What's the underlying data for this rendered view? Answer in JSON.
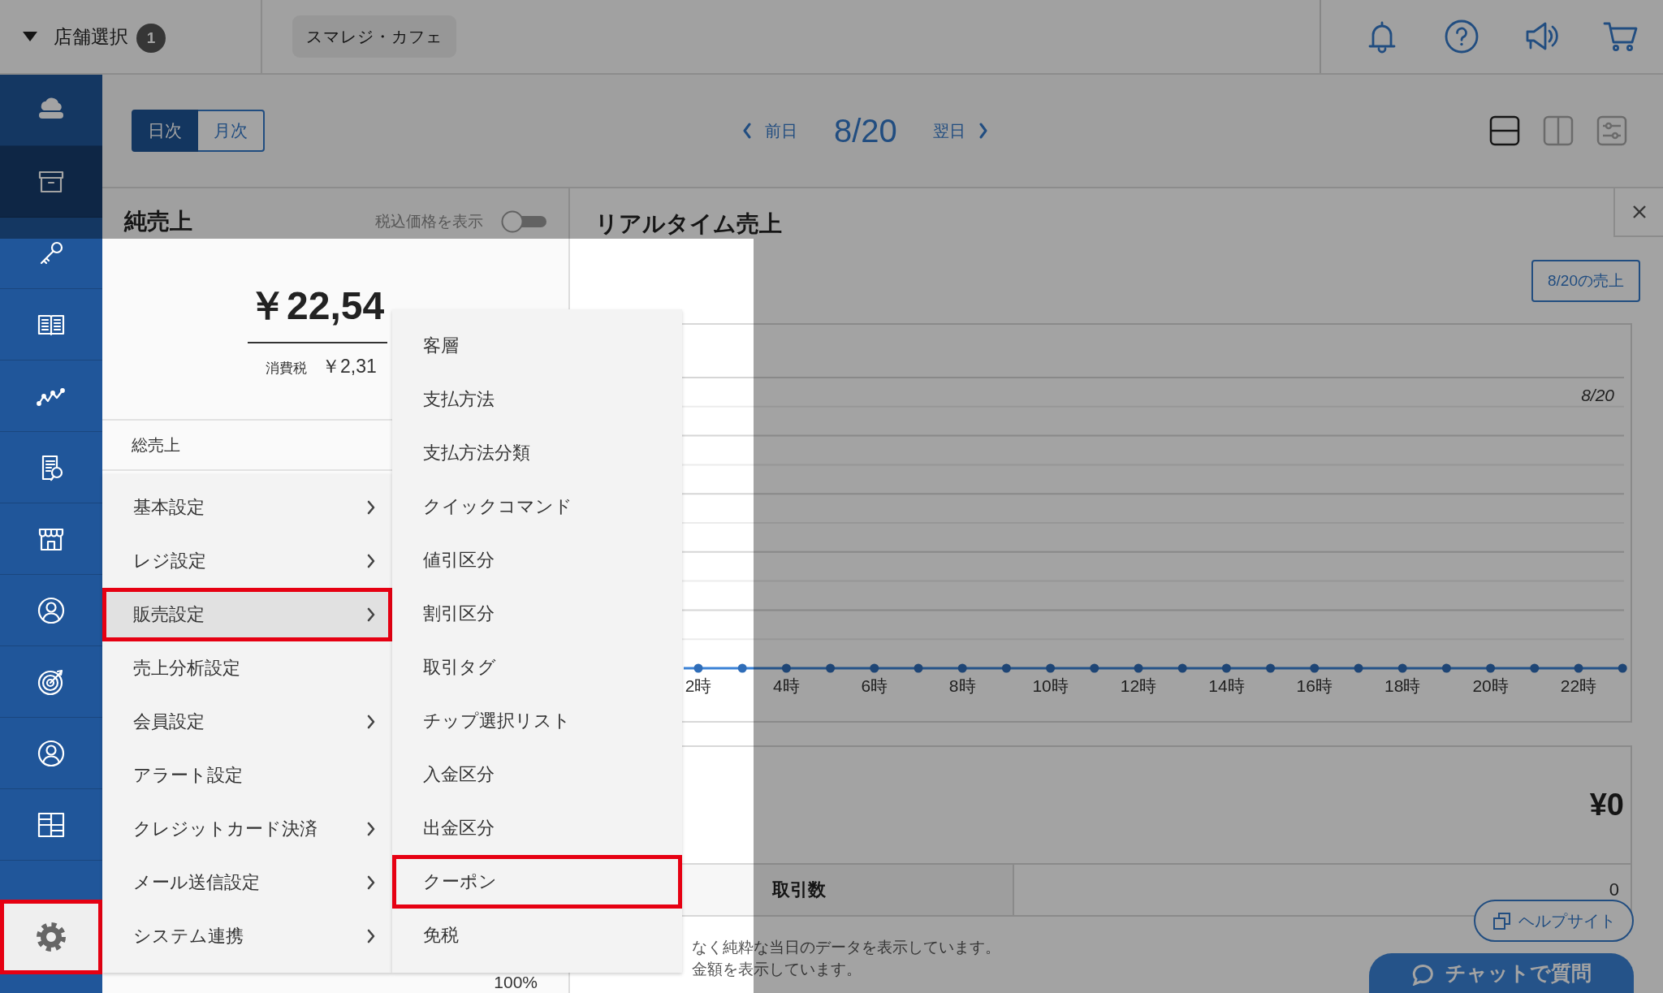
{
  "header": {
    "store_select": "店舗選択",
    "store_count": "1",
    "store_tag": "スマレジ・カフェ"
  },
  "sidebar": {
    "items": [
      {
        "selected": false
      },
      {
        "selected": true
      },
      {
        "selected": false
      },
      {
        "selected": false
      },
      {
        "selected": false
      },
      {
        "selected": false
      },
      {
        "selected": false
      },
      {
        "selected": false
      },
      {
        "selected": false
      },
      {
        "selected": false
      },
      {
        "selected": false
      }
    ],
    "settings": {
      "selected": true,
      "highlighted": true
    }
  },
  "toolbar": {
    "period_tabs": [
      {
        "label": "日次",
        "selected": true
      },
      {
        "label": "月次",
        "selected": false
      }
    ],
    "prev_day": "前日",
    "date": "8/20",
    "next_day": "翌日",
    "view_modes": [
      {
        "selected": true
      },
      {
        "selected": false
      },
      {
        "selected": false
      }
    ]
  },
  "net_sales": {
    "title": "純売上",
    "tax_toggle": {
      "label": "税込価格を表示",
      "on": false
    },
    "amount": "￥22,54",
    "tax_label": "消費税",
    "tax_amount": "￥2,31",
    "rows": [
      {
        "label": "総売上"
      }
    ],
    "share": "100%"
  },
  "realtime_sales": {
    "title": "リアルタイム売上",
    "date_button": "8/20の売上",
    "chart": {
      "legend": "8/20",
      "x_labels": [
        "2時",
        "4時",
        "6時",
        "8時",
        "10時",
        "12時",
        "14時",
        "16時",
        "18時",
        "20時",
        "22時"
      ]
    },
    "summary": {
      "amount": "¥0",
      "rows": [
        {
          "label": "取引数",
          "value": "0"
        }
      ]
    },
    "notes": [
      "なく純粋な当日のデータを表示しています。",
      "金額を表示しています。"
    ]
  },
  "help_button": "ヘルプサイト",
  "chat_button": "チャットで質問",
  "settings_menu": {
    "items": [
      {
        "label": "基本設定",
        "has_submenu": true,
        "selected": false,
        "highlighted": false
      },
      {
        "label": "レジ設定",
        "has_submenu": true,
        "selected": false,
        "highlighted": false
      },
      {
        "label": "販売設定",
        "has_submenu": true,
        "selected": true,
        "highlighted": true
      },
      {
        "label": "売上分析設定",
        "has_submenu": false,
        "selected": false,
        "highlighted": false
      },
      {
        "label": "会員設定",
        "has_submenu": true,
        "selected": false,
        "highlighted": false
      },
      {
        "label": "アラート設定",
        "has_submenu": false,
        "selected": false,
        "highlighted": false
      },
      {
        "label": "クレジットカード決済",
        "has_submenu": true,
        "selected": false,
        "highlighted": false
      },
      {
        "label": "メール送信設定",
        "has_submenu": true,
        "selected": false,
        "highlighted": false
      },
      {
        "label": "システム連携",
        "has_submenu": true,
        "selected": false,
        "highlighted": false
      }
    ]
  },
  "submenu": {
    "items": [
      {
        "label": "客層",
        "selected": false,
        "highlighted": false
      },
      {
        "label": "支払方法",
        "selected": false,
        "highlighted": false
      },
      {
        "label": "支払方法分類",
        "selected": false,
        "highlighted": false
      },
      {
        "label": "クイックコマンド",
        "selected": false,
        "highlighted": false
      },
      {
        "label": "値引区分",
        "selected": false,
        "highlighted": false
      },
      {
        "label": "割引区分",
        "selected": false,
        "highlighted": false
      },
      {
        "label": "取引タグ",
        "selected": false,
        "highlighted": false
      },
      {
        "label": "チップ選択リスト",
        "selected": false,
        "highlighted": false
      },
      {
        "label": "入金区分",
        "selected": false,
        "highlighted": false
      },
      {
        "label": "出金区分",
        "selected": false,
        "highlighted": false
      },
      {
        "label": "クーポン",
        "selected": false,
        "highlighted": true
      },
      {
        "label": "免税",
        "selected": false,
        "highlighted": false
      }
    ]
  }
}
